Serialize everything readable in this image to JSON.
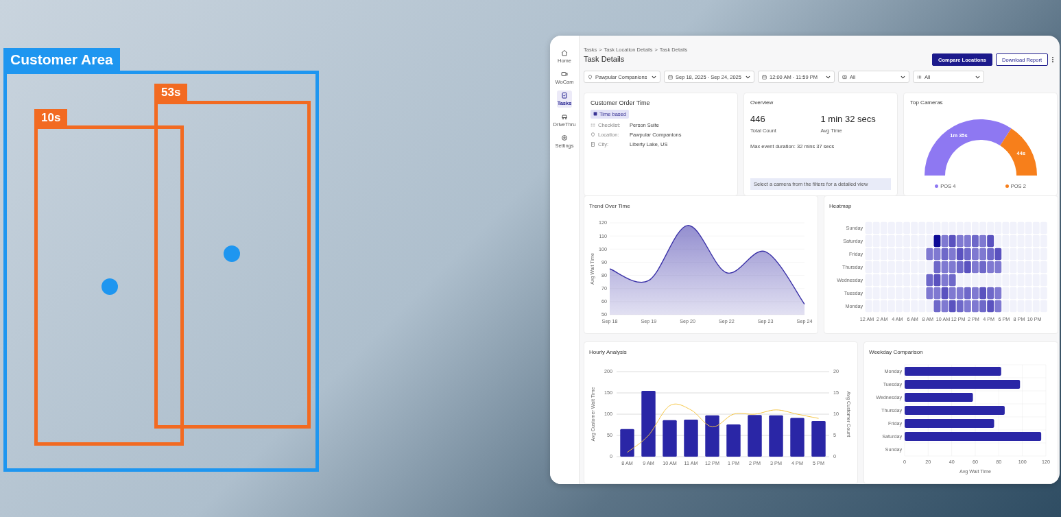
{
  "photo": {
    "detections": [
      {
        "label": "Customer Area",
        "color": "#1e96f0",
        "kind": "area"
      },
      {
        "label": "10s",
        "color": "#f26a21",
        "kind": "person"
      },
      {
        "label": "53s",
        "color": "#f26a21",
        "kind": "person"
      }
    ]
  },
  "sidebar": {
    "items": [
      {
        "label": "Home",
        "selected": false
      },
      {
        "label": "WoCam",
        "selected": false
      },
      {
        "label": "Tasks",
        "selected": true
      },
      {
        "label": "DriveThru",
        "selected": false
      },
      {
        "label": "Settings",
        "selected": false
      }
    ]
  },
  "breadcrumb": {
    "items": [
      "Tasks",
      "Task Location Details",
      "Task Details"
    ],
    "separator": ">"
  },
  "title": "Task Details",
  "buttons": [
    {
      "label": "Compare Locations",
      "kind": "primary"
    },
    {
      "label": "Download Report",
      "kind": "secondary"
    }
  ],
  "filters": [
    {
      "value": "Pawpular Companions",
      "kind": "location"
    },
    {
      "value": "Sep 18, 2025 - Sep 24, 2025",
      "kind": "date"
    },
    {
      "value": "12:00 AM - 11:59 PM",
      "kind": "time"
    },
    {
      "value": "All",
      "kind": "camera"
    },
    {
      "value": "All",
      "kind": "list"
    }
  ],
  "task_card": {
    "title": "Customer Order Time",
    "tag": "Time based",
    "details": [
      {
        "label": "Checklist:",
        "value": "Person Suite",
        "kind": "checklist"
      },
      {
        "label": "Location:",
        "value": "Pawpular Companions",
        "kind": "location"
      },
      {
        "label": "City:",
        "value": "Liberty Lake, US",
        "kind": "city"
      }
    ]
  },
  "overview": {
    "title": "Overview",
    "stats": [
      {
        "value": "446",
        "label": "Total Count"
      },
      {
        "value": "1 min 32 secs",
        "label": "Avg Time"
      }
    ],
    "max_duration": "Max event duration: 32 mins 37 secs",
    "hint": "Select a camera from the filters for a detailed view"
  },
  "top_cameras": {
    "title": "Top Cameras",
    "chart_data": {
      "type": "donut",
      "categories": [
        "POS 4",
        "POS 2"
      ],
      "values": [
        68.3,
        31.7
      ],
      "colors": [
        "#8e78f2",
        "#f77f1b"
      ]
    },
    "slice_times": [
      "1m 35s",
      "44s"
    ]
  },
  "trend": {
    "title": "Trend Over Time",
    "chart_data": {
      "type": "area",
      "grid": true,
      "ylabel": "Avg Wait Time",
      "categories": [
        "Sep 18",
        "Sep 19",
        "Sep 20",
        "Sep 22",
        "Sep 23",
        "Sep 24"
      ],
      "ylim": [
        50,
        120
      ],
      "yticks": [
        50,
        60,
        70,
        80,
        90,
        100,
        110,
        120
      ],
      "series": [
        {
          "color": "#3b32a8",
          "values": [
            85,
            76,
            118,
            82,
            98,
            58
          ]
        }
      ]
    }
  },
  "heatmap": {
    "title": "Heatmap",
    "rows": [
      "Sunday",
      "Saturday",
      "Friday",
      "Thursday",
      "Wednesday",
      "Tuesday",
      "Monday"
    ],
    "columns": [
      "12 AM",
      "2 AM",
      "4 AM",
      "6 AM",
      "8 AM",
      "10 AM",
      "12 PM",
      "2 PM",
      "4 PM",
      "6 PM",
      "8 PM",
      "10 PM"
    ]
  },
  "hourly": {
    "title": "Hourly Analysis",
    "chart_data": {
      "type": "bar",
      "grid": true,
      "ylabel": "Avg Customer Wait Time",
      "y2label": "Avg Customer Count",
      "categories": [
        "8 AM",
        "9 AM",
        "10 AM",
        "11 AM",
        "12 PM",
        "1 PM",
        "2 PM",
        "3 PM",
        "4 PM",
        "5 PM"
      ],
      "ylim": [
        0,
        200
      ],
      "yticks": [
        0,
        50,
        100,
        150,
        200
      ],
      "y2lim": [
        0,
        20
      ],
      "y2ticks": [
        0,
        5,
        10,
        15,
        20
      ],
      "series": [
        {
          "color": "#2a26a6",
          "values": [
            65,
            155,
            86,
            87,
            97,
            76,
            98,
            97,
            91,
            84
          ]
        },
        {
          "color": "#f5c542",
          "axis": "y2",
          "type": "line",
          "values": [
            1,
            5,
            12,
            11,
            7,
            10,
            10,
            11,
            10,
            9
          ]
        }
      ]
    }
  },
  "weekday": {
    "title": "Weekday Comparison",
    "chart_data": {
      "type": "bar",
      "orientation": "horizontal",
      "grid": true,
      "xlabel": "Avg Wait Time",
      "categories": [
        "Monday",
        "Tuesday",
        "Wednesday",
        "Thursday",
        "Friday",
        "Saturday",
        "Sunday"
      ],
      "xlim": [
        0,
        120
      ],
      "xticks": [
        0,
        20,
        40,
        60,
        80,
        100,
        120
      ],
      "series": [
        {
          "color": "#2a26a6",
          "values": [
            82,
            98,
            58,
            85,
            76,
            116,
            null
          ]
        }
      ]
    }
  }
}
